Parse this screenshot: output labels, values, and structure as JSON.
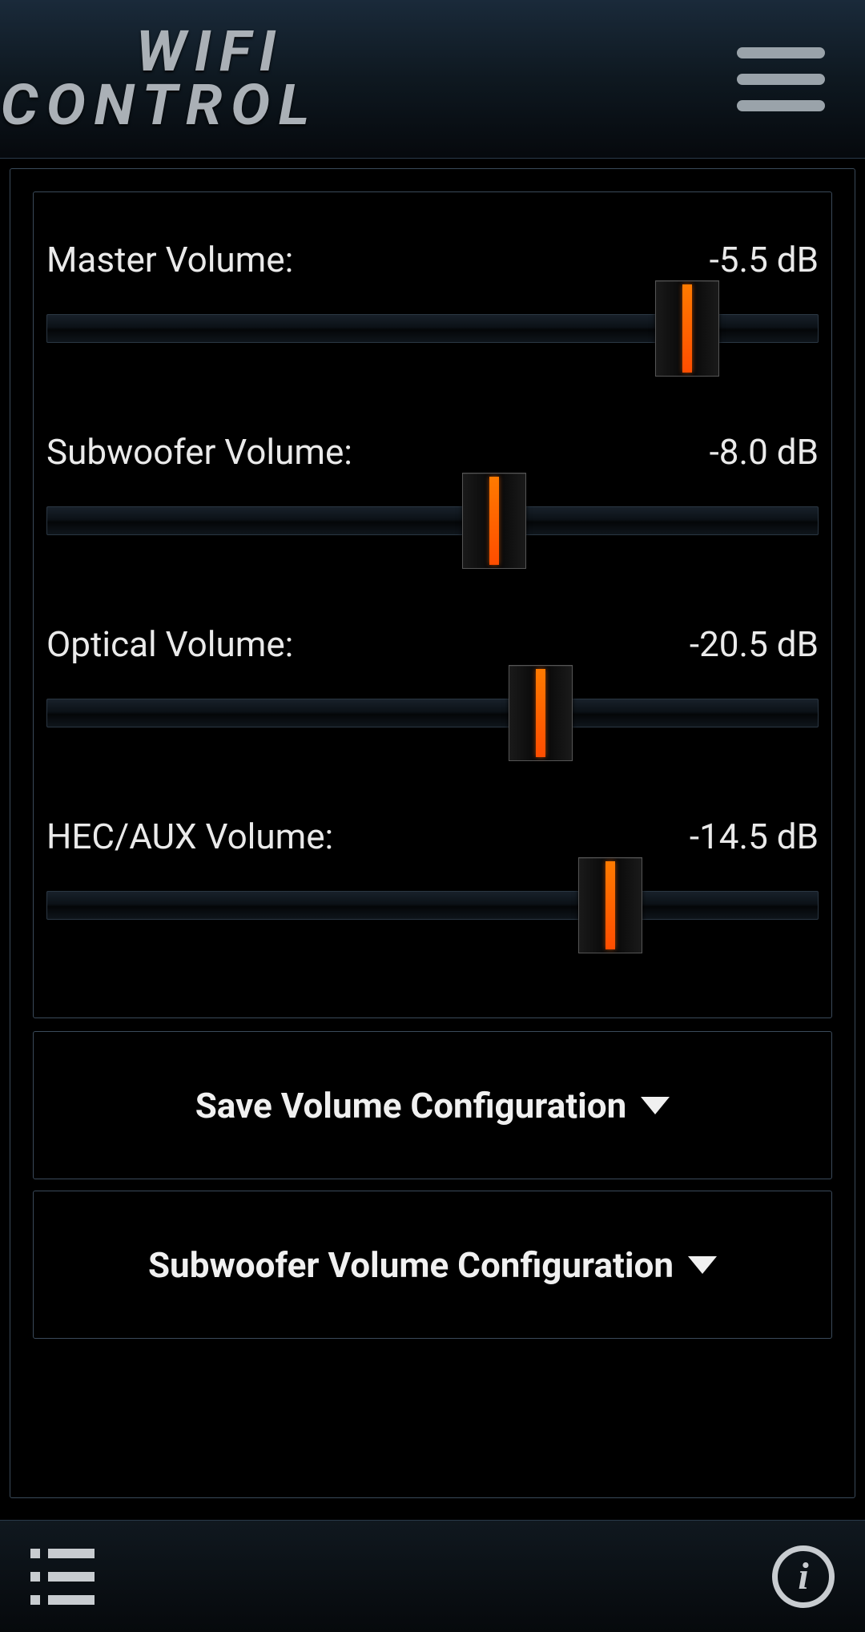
{
  "header": {
    "title_line1": "WIFI",
    "title_line2": "CONTROL"
  },
  "sliders": [
    {
      "label": "Master Volume:",
      "value": "-5.5 dB",
      "position_pct": 83
    },
    {
      "label": "Subwoofer Volume:",
      "value": "-8.0 dB",
      "position_pct": 58
    },
    {
      "label": "Optical Volume:",
      "value": "-20.5 dB",
      "position_pct": 64
    },
    {
      "label": "HEC/AUX Volume:",
      "value": "-14.5 dB",
      "position_pct": 73
    }
  ],
  "buttons": {
    "save_config": "Save Volume Configuration",
    "sub_config": "Subwoofer Volume Configuration"
  },
  "footer": {
    "info_glyph": "i"
  }
}
